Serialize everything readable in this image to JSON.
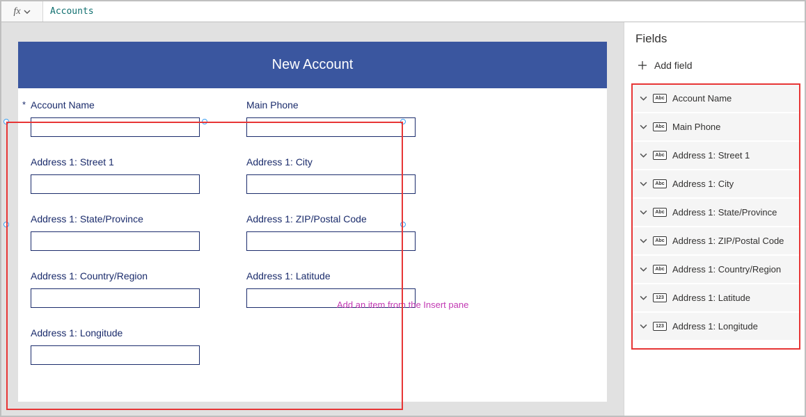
{
  "formula_bar": {
    "fx": "fx",
    "value": "Accounts"
  },
  "form_header": "New Account",
  "required_marker": "*",
  "fields_left": [
    {
      "label": "Account Name",
      "required": true
    },
    {
      "label": "Address 1: Street 1"
    },
    {
      "label": "Address 1: State/Province"
    },
    {
      "label": "Address 1: Country/Region"
    },
    {
      "label": "Address 1: Longitude"
    }
  ],
  "fields_right": [
    {
      "label": "Main Phone"
    },
    {
      "label": "Address 1: City"
    },
    {
      "label": "Address 1: ZIP/Postal Code"
    },
    {
      "label": "Address 1: Latitude"
    }
  ],
  "hint": "Add an item from the Insert pane",
  "panel": {
    "title": "Fields",
    "add_field": "Add field",
    "items": [
      {
        "type": "Abc",
        "label": "Account Name"
      },
      {
        "type": "Abc",
        "label": "Main Phone"
      },
      {
        "type": "Abc",
        "label": "Address 1: Street 1"
      },
      {
        "type": "Abc",
        "label": "Address 1: City"
      },
      {
        "type": "Abc",
        "label": "Address 1: State/Province"
      },
      {
        "type": "Abc",
        "label": "Address 1: ZIP/Postal Code"
      },
      {
        "type": "Abc",
        "label": "Address 1: Country/Region"
      },
      {
        "type": "123",
        "label": "Address 1: Latitude"
      },
      {
        "type": "123",
        "label": "Address 1: Longitude"
      }
    ]
  }
}
